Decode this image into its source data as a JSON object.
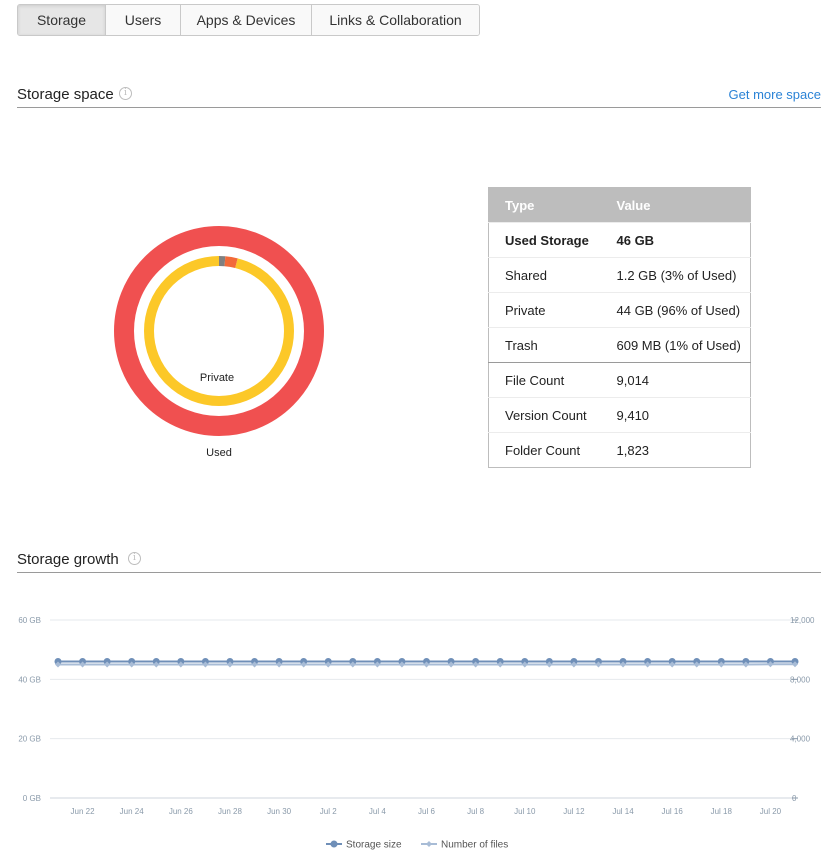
{
  "tabs": [
    {
      "label": "Storage",
      "active": true
    },
    {
      "label": "Users"
    },
    {
      "label": "Apps & Devices"
    },
    {
      "label": "Links & Collaboration"
    }
  ],
  "storage_space": {
    "title": "Storage space",
    "info_icon": "i",
    "get_more": "Get more space"
  },
  "donut": {
    "outer_label": "Used",
    "inner_label": "Private",
    "colors": {
      "used": "#f05050",
      "private": "#fcc828",
      "shared": "#808080",
      "trash": "#f26a3a"
    },
    "private_fraction": 0.96,
    "shared_fraction": 0.03,
    "trash_fraction": 0.01
  },
  "table": {
    "headers": [
      "Type",
      "Value"
    ],
    "rows": [
      {
        "type": "Used Storage",
        "value": "46 GB"
      },
      {
        "type": "Shared",
        "value": "1.2 GB (3% of Used)"
      },
      {
        "type": "Private",
        "value": "44 GB (96% of Used)"
      },
      {
        "type": "Trash",
        "value": "609 MB (1% of Used)"
      },
      {
        "type": "File Count",
        "value": "9,014"
      },
      {
        "type": "Version Count",
        "value": "9,410"
      },
      {
        "type": "Folder Count",
        "value": "1,823"
      }
    ]
  },
  "storage_growth": {
    "title": "Storage growth",
    "info_icon": "i"
  },
  "chart_data": {
    "type": "line",
    "x_ticks": [
      "Jun 22",
      "Jun 24",
      "Jun 26",
      "Jun 28",
      "Jun 30",
      "Jul 2",
      "Jul 4",
      "Jul 6",
      "Jul 8",
      "Jul 10",
      "Jul 12",
      "Jul 14",
      "Jul 16",
      "Jul 18",
      "Jul 20"
    ],
    "y_left_ticks": [
      "60 GB",
      "40 GB",
      "20 GB",
      "0 GB"
    ],
    "y_left_values": [
      60,
      40,
      20,
      0
    ],
    "y_right_ticks": [
      "12,000",
      "8,000",
      "4,000",
      "0"
    ],
    "y_right_values": [
      12000,
      8000,
      4000,
      0
    ],
    "ylim_left": [
      0,
      60
    ],
    "ylim_right": [
      0,
      12000
    ],
    "series": [
      {
        "name": "Storage size",
        "axis": "left",
        "color": "#6f8fb8",
        "values": [
          46,
          46,
          46,
          46,
          46,
          46,
          46,
          46,
          46,
          46,
          46,
          46,
          46,
          46,
          46,
          46,
          46,
          46,
          46,
          46,
          46,
          46,
          46,
          46,
          46,
          46,
          46,
          46,
          46,
          46,
          46
        ]
      },
      {
        "name": "Number of files",
        "axis": "right",
        "color": "#a8bcd6",
        "values": [
          9000,
          9000,
          9000,
          9000,
          9000,
          9000,
          9000,
          9000,
          9000,
          9000,
          9000,
          9000,
          9000,
          9000,
          9000,
          9000,
          9000,
          9000,
          9000,
          9000,
          9000,
          9000,
          9000,
          9000,
          9000,
          9000,
          9000,
          9000,
          9000,
          9014,
          9014
        ]
      }
    ]
  }
}
